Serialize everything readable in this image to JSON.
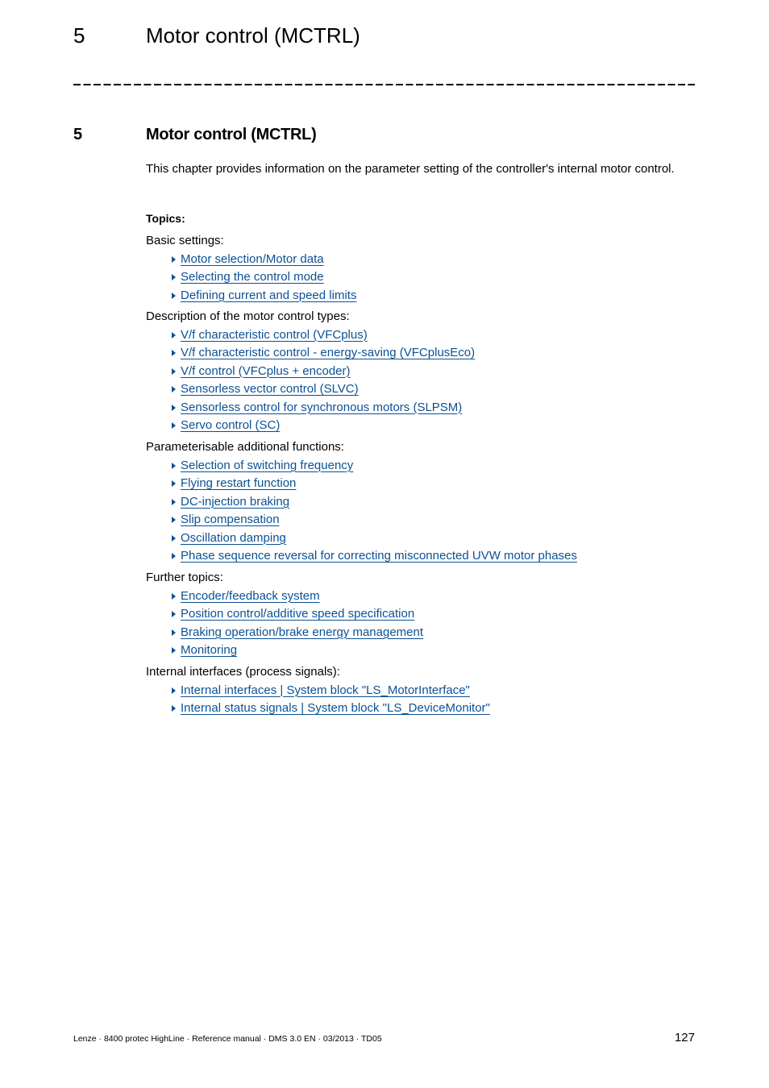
{
  "running_header": {
    "chapter_number": "5",
    "chapter_title": "Motor control (MCTRL)"
  },
  "heading": {
    "number": "5",
    "title": "Motor control (MCTRL)"
  },
  "intro": "This chapter provides information on the parameter setting of the controller's internal motor control.",
  "topics_label": "Topics:",
  "groups": [
    {
      "label": "Basic settings:",
      "links": [
        "Motor selection/Motor data",
        "Selecting the control mode",
        "Defining current and speed limits"
      ]
    },
    {
      "label": "Description of the motor control types:",
      "links": [
        "V/f characteristic control (VFCplus)",
        "V/f characteristic control - energy-saving (VFCplusEco)",
        "V/f control (VFCplus + encoder)",
        "Sensorless vector control (SLVC)",
        "Sensorless control for synchronous motors (SLPSM)",
        "Servo control (SC)"
      ]
    },
    {
      "label": "Parameterisable additional functions:",
      "links": [
        "Selection of switching frequency",
        "Flying restart function",
        "DC-injection braking",
        "Slip compensation",
        "Oscillation damping",
        "Phase sequence reversal for correcting misconnected UVW motor phases"
      ]
    },
    {
      "label": "Further topics:",
      "links": [
        "Encoder/feedback system",
        "Position control/additive speed specification",
        "Braking operation/brake energy management",
        "Monitoring"
      ]
    },
    {
      "label": "Internal interfaces (process signals):",
      "links": [
        "Internal interfaces | System block \"LS_MotorInterface\"",
        "Internal status signals | System block \"LS_DeviceMonitor\""
      ]
    }
  ],
  "footer": {
    "text": "Lenze · 8400 protec HighLine · Reference manual · DMS 3.0 EN · 03/2013 · TD05",
    "page_number": "127"
  },
  "colors": {
    "link": "#0b5194"
  }
}
